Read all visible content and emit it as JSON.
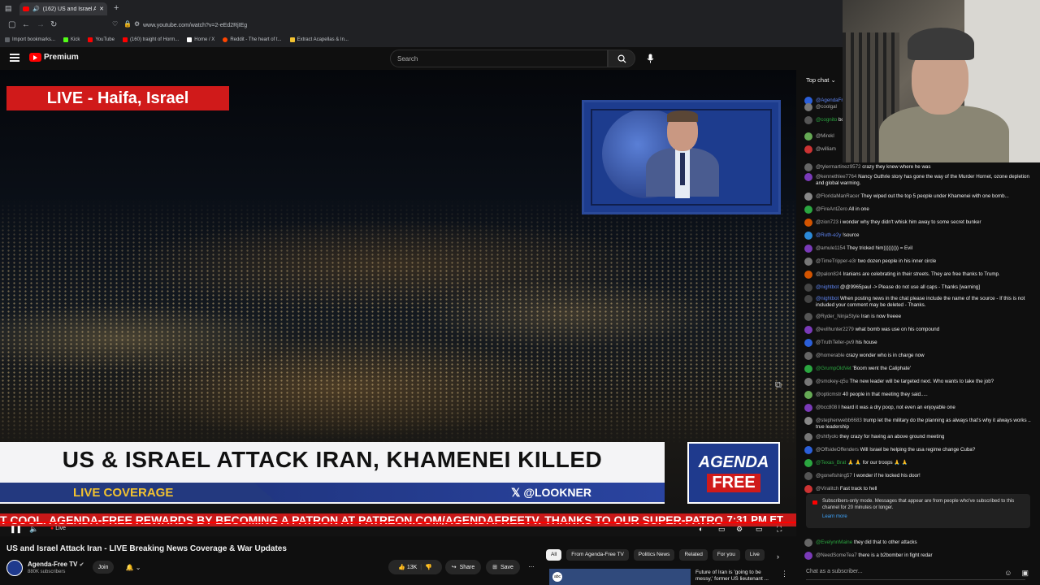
{
  "browser": {
    "tab_title": "(162) US and Israel Attack I...",
    "url": "www.youtube.com/watch?v=2-eEd2RjIEg",
    "bookmarks": [
      "Import bookmarks...",
      "Kick",
      "YouTube",
      "(160) traight of Horm...",
      "Home / X",
      "Reddit - The heart of t...",
      "Extract Acapellas & In..."
    ]
  },
  "yt": {
    "logo": "Premium",
    "search_placeholder": "Search"
  },
  "video": {
    "live_banner": "LIVE - Haifa, Israel",
    "headline": "US & ISRAEL ATTACK IRAN, KHAMENEI KILLED",
    "coverage": "LIVE COVERAGE",
    "handle": "𝕏 @LOOKNER",
    "logo_top": "AGENDA",
    "logo_bottom": "FREE",
    "ticker": "T COOL. AGENDA-FREE REWARDS BY BECOMING A PATRON AT PATREON.COM/AGENDAFREETV. THANKS TO OUR SUPER-PATRONS",
    "ticker_time": "7:31 PM ET",
    "live_label": "Live",
    "title": "US and Israel Attack Iran - LIVE Breaking News Coverage & War Updates",
    "channel": "Agenda-Free TV",
    "subs": "880K subscribers",
    "join": "Join",
    "likes": "13K",
    "share": "Share",
    "save": "Save"
  },
  "chips": [
    "All",
    "From Agenda-Free TV",
    "Politics News",
    "Related",
    "For you",
    "Live"
  ],
  "recommended": {
    "title": "Future of Iran is 'going to be messy,' former US lieutenant ..."
  },
  "chat": {
    "mode": "Top chat",
    "messages": [
      {
        "author": "@AgendaFreeTV",
        "text": "",
        "type": "mod",
        "color": "#2b5fd9"
      },
      {
        "author": "@coolgal",
        "text": "",
        "type": "norm",
        "color": "#777"
      },
      {
        "author": "@cognito",
        "text": "border w...",
        "type": "mem",
        "color": "#555"
      },
      {
        "author": "@Mirekl",
        "text": "",
        "type": "norm",
        "color": "#6a5"
      },
      {
        "author": "@william",
        "text": "",
        "type": "norm",
        "color": "#c33"
      },
      {
        "author": "@tylermartinez9572",
        "text": "crazy they knew where he was",
        "type": "norm",
        "color": "#666"
      },
      {
        "author": "@kennethlee7764",
        "text": "Nancy Guthrie story has gone the way of the Murder Hornet, ozone depletion and global warming.",
        "type": "norm",
        "color": "#7a3ab8"
      },
      {
        "author": "@FloridaManRacer",
        "text": "They wiped out the top 5 people under Khamenei with one bomb...",
        "type": "norm",
        "color": "#888"
      },
      {
        "author": "@FireAntZero",
        "text": "All in one",
        "type": "norm",
        "color": "#2ba640"
      },
      {
        "author": "@zion723",
        "text": "i wonder why they didn't whisk him away to some secret bunker",
        "type": "norm",
        "color": "#d35400"
      },
      {
        "author": "@Ruth-e2y",
        "text": "!source",
        "type": "mod",
        "color": "#2b8ad9"
      },
      {
        "author": "@amule1154",
        "text": "They tricked him))))))))) = Evil",
        "type": "norm",
        "color": "#7a3ab8"
      },
      {
        "author": "@TimeTripper-e3r",
        "text": "two dozen people in his inner circle",
        "type": "norm",
        "color": "#777"
      },
      {
        "author": "@palon824",
        "text": "Iranians are celebrating in their streets. They are free thanks to Trump.",
        "type": "norm",
        "color": "#d35400"
      },
      {
        "author": "@nightbot",
        "text": "@@9965paul -> Please do not use all caps - Thanks [warning]",
        "type": "mod",
        "color": "#444"
      },
      {
        "author": "@nightbot",
        "text": "When posting news in the chat please include the name of the source - If this is not included your comment may be deleted - Thanks.",
        "type": "mod",
        "color": "#444"
      },
      {
        "author": "@Ryder_NinjaStyle",
        "text": "Iran is now freeee",
        "type": "norm",
        "color": "#555"
      },
      {
        "author": "@evilhunter2279",
        "text": "what bomb was use on his compound",
        "type": "norm",
        "color": "#7a3ab8"
      },
      {
        "author": "@TruthTeller-pv9",
        "text": "his house",
        "type": "norm",
        "color": "#2b5fd9"
      },
      {
        "author": "@homerable",
        "text": "crazy wonder who is in charge now",
        "type": "norm",
        "color": "#666"
      },
      {
        "author": "@GrumpOldVet",
        "text": "'Boom went the Caliphate'",
        "type": "mem",
        "color": "#2ba640"
      },
      {
        "author": "@smokey-q5u",
        "text": "The new leader will be targeted next. Who wants to take the job?",
        "type": "norm",
        "color": "#777"
      },
      {
        "author": "@opticmstr",
        "text": "40 people in that meeting they said.....",
        "type": "norm",
        "color": "#6a5"
      },
      {
        "author": "@bcc808",
        "text": "I heard it was a dry poop, not even an enjoyable one",
        "type": "norm",
        "color": "#7a3ab8"
      },
      {
        "author": "@stephenwebb6683",
        "text": "trump let the military do the planning as always that's why it always works .. true leadership",
        "type": "norm",
        "color": "#888"
      },
      {
        "author": "@shtfyolo",
        "text": "they crazy for having an above ground meeting",
        "type": "norm",
        "color": "#777"
      },
      {
        "author": "@OffsideOffenders",
        "text": "Will Israel be helping the usa regime change Cuba?",
        "type": "norm",
        "color": "#2b5fd9"
      },
      {
        "author": "@Texas_Brat",
        "text": "🙏 🙏 for our troops 🙏 🙏",
        "type": "mem",
        "color": "#2ba640"
      },
      {
        "author": "@gonefishing57",
        "text": "I wonder if he locked his door!",
        "type": "norm",
        "color": "#555"
      },
      {
        "author": "@Viralitch",
        "text": "Fast track to hell",
        "type": "norm",
        "color": "#c33"
      },
      {
        "author": "@EvelynnMaine",
        "text": "they did that to other attacks",
        "type": "mem",
        "color": "#666"
      },
      {
        "author": "@NeedSomeTea7",
        "text": "there is a b2bomber in fight redar",
        "type": "norm",
        "color": "#7a3ab8"
      }
    ],
    "notice": "Subscribers-only mode. Messages that appear are from people who've subscribed to this channel for 20 minutes or longer.",
    "learn_more": "Learn more",
    "input_placeholder": "Chat as a subscriber..."
  }
}
